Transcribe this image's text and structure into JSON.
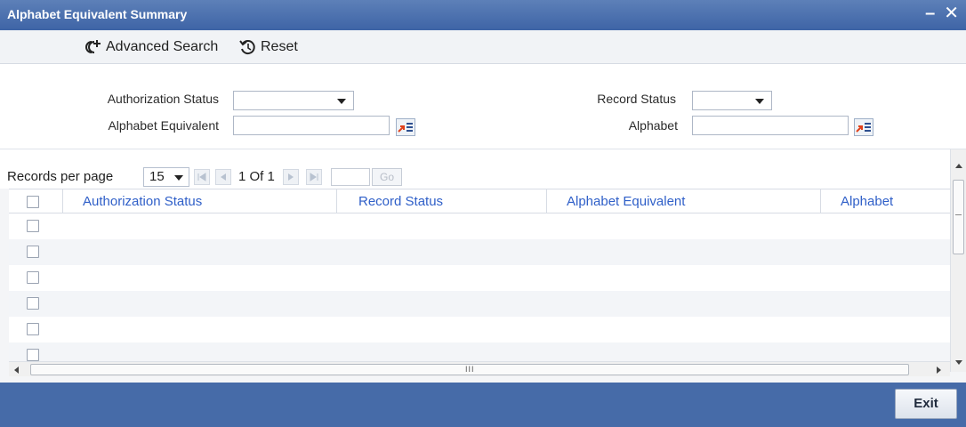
{
  "window": {
    "title": "Alphabet Equivalent Summary",
    "minimize": "–",
    "close": "✕"
  },
  "toolbar": {
    "advanced_search": "Advanced Search",
    "reset": "Reset"
  },
  "search": {
    "auth_status_label": "Authorization Status",
    "alphabet_equiv_label": "Alphabet Equivalent",
    "record_status_label": "Record Status",
    "alphabet_label": "Alphabet",
    "auth_status_value": "",
    "record_status_value": "",
    "alphabet_equiv_value": "",
    "alphabet_value": ""
  },
  "pager": {
    "records_per_page_label": "Records per page",
    "records_per_page_value": "15",
    "page_info": "1 Of 1",
    "go_label": "Go"
  },
  "table": {
    "columns": [
      "Authorization Status",
      "Record Status",
      "Alphabet Equivalent",
      "Alphabet"
    ],
    "row_count": 7
  },
  "footer": {
    "exit_label": "Exit"
  }
}
